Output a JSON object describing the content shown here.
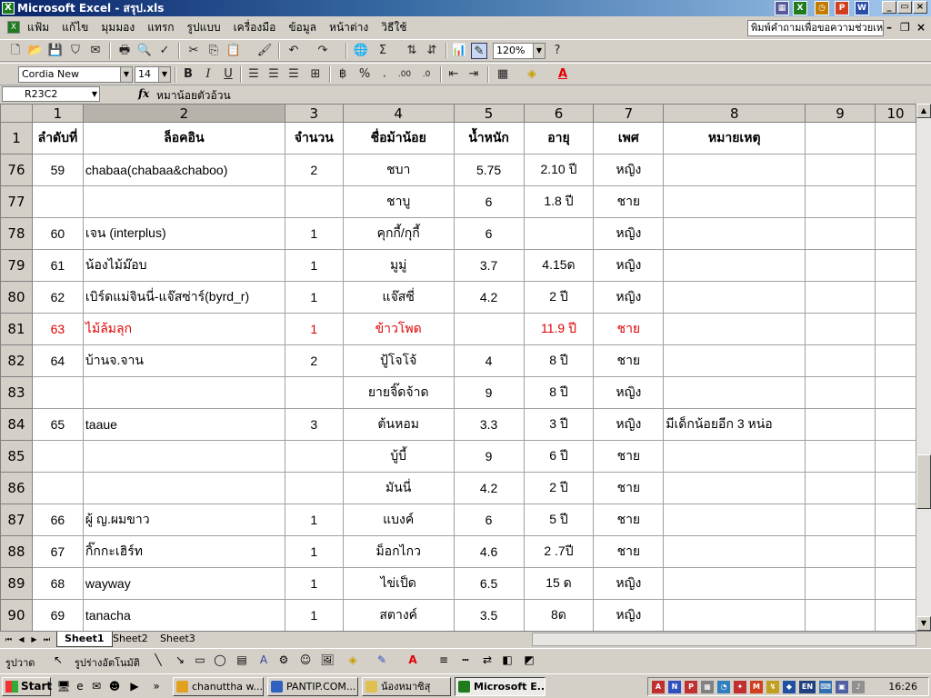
{
  "window": {
    "title": "Microsoft Excel - สรุป.xls",
    "app_icon": "excel-icon"
  },
  "menu": [
    "แฟ้ม",
    "แก้ไข",
    "มุมมอง",
    "แทรก",
    "รูปแบบ",
    "เครื่องมือ",
    "ข้อมูล",
    "หน้าต่าง",
    "วิธีใช้"
  ],
  "help_box": {
    "value": "พิมพ์คำถามเพื่อขอความช่วยเหลือ"
  },
  "toolbar": {
    "zoom": "120%",
    "font": "Cordia New",
    "size": "14"
  },
  "formula_bar": {
    "name_box": "R23C2",
    "fx": "fx",
    "content": "หมาน้อยตัวอ้วน"
  },
  "columns": [
    "1",
    "2",
    "3",
    "4",
    "5",
    "6",
    "7",
    "8",
    "9",
    "10"
  ],
  "selected_column": 2,
  "header_row": {
    "num": "1",
    "cells": [
      "ลำดับที่",
      "ล็อคอิน",
      "จำนวน",
      "ชื่อม้าน้อย",
      "น้ำหนัก",
      "อายุ",
      "เพศ",
      "หมายเหตุ",
      "",
      ""
    ]
  },
  "rows": [
    {
      "num": "76",
      "cells": [
        "59",
        "chabaa(chabaa&chaboo)",
        "2",
        "ชบา",
        "5.75",
        "2.10 ปี",
        "หญิง",
        "",
        "",
        ""
      ]
    },
    {
      "num": "77",
      "cells": [
        "",
        "",
        "",
        "ชาบู",
        "6",
        "1.8 ปี",
        "ชาย",
        "",
        "",
        ""
      ]
    },
    {
      "num": "78",
      "cells": [
        "60",
        "เจน (interplus)",
        "1",
        "คุกกี้/กุกี้",
        "6",
        "",
        "หญิง",
        "",
        "",
        ""
      ]
    },
    {
      "num": "79",
      "cells": [
        "61",
        "น้องไม้ม๊อบ",
        "1",
        "มูมู่",
        "3.7",
        "4.15ด",
        "หญิง",
        "",
        "",
        ""
      ]
    },
    {
      "num": "80",
      "cells": [
        "62",
        "เบิร์ดแม่จินนี่-แจ๊สซ่าร์(byrd_r)",
        "1",
        "แจ๊สซี่",
        "4.2",
        "2 ปี",
        "หญิง",
        "",
        "",
        ""
      ]
    },
    {
      "num": "81",
      "red": true,
      "cells": [
        "63",
        "ไม้ล้มลุก",
        "1",
        "ข้าวโพด",
        "",
        "11.9 ปี",
        "ชาย",
        "",
        "",
        ""
      ]
    },
    {
      "num": "82",
      "cells": [
        "64",
        "บ้านจ.จาน",
        "2",
        "ปู้โจโจ้",
        "4",
        "8 ปี",
        "ชาย",
        "",
        "",
        ""
      ]
    },
    {
      "num": "83",
      "cells": [
        "",
        "",
        "",
        "ยายจิ๊ดจ้าด",
        "9",
        "8 ปี",
        "หญิง",
        "",
        "",
        ""
      ]
    },
    {
      "num": "84",
      "cells": [
        "65",
        "taaue",
        "3",
        "ต้นหอม",
        "3.3",
        "3 ปี",
        "หญิง",
        "มีเด็กน้อยอีก 3 หน่อ",
        "",
        ""
      ]
    },
    {
      "num": "85",
      "cells": [
        "",
        "",
        "",
        "บู้บี้",
        "9",
        "6 ปี",
        "ชาย",
        "",
        "",
        ""
      ]
    },
    {
      "num": "86",
      "cells": [
        "",
        "",
        "",
        "มันนี่",
        "4.2",
        "2 ปี",
        "ชาย",
        "",
        "",
        ""
      ]
    },
    {
      "num": "87",
      "cells": [
        "66",
        "ผู้ ญ.ผมขาว",
        "1",
        "แบงค์",
        "6",
        "5 ปี",
        "ชาย",
        "",
        "",
        ""
      ]
    },
    {
      "num": "88",
      "cells": [
        "67",
        "กิ๊กกะเฮิร์ท",
        "1",
        "ม็อกไกว",
        "4.6",
        "2 .7ปี",
        "ชาย",
        "",
        "",
        ""
      ]
    },
    {
      "num": "89",
      "cells": [
        "68",
        "wayway",
        "1",
        "ไข่เป็ด",
        "6.5",
        "15 ด",
        "หญิง",
        "",
        "",
        ""
      ]
    },
    {
      "num": "90",
      "cells": [
        "69",
        "tanacha",
        "1",
        "สตางค์",
        "3.5",
        "8ด",
        "หญิง",
        "",
        "",
        ""
      ]
    }
  ],
  "sheets": [
    "Sheet1",
    "Sheet2",
    "Sheet3"
  ],
  "active_sheet": "Sheet1",
  "drawing": {
    "draw_menu": "รูปวาด",
    "autoshapes": "รูปร่างอัตโนมัติ"
  },
  "taskbar": {
    "start": "Start",
    "tasks": [
      "chanuttha w...",
      "PANTIP.COM...",
      "น้องหมาซิสุ",
      "Microsoft E..."
    ],
    "active_task": 3,
    "clock": "16:26",
    "lang": "EN"
  }
}
